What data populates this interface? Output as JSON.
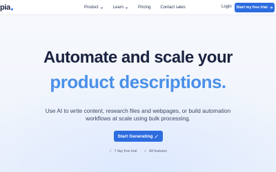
{
  "header": {
    "logo_text": "pia",
    "nav": [
      {
        "label": "Product",
        "has_dropdown": true
      },
      {
        "label": "Learn",
        "has_dropdown": true
      },
      {
        "label": "Pricing",
        "has_dropdown": false
      },
      {
        "label": "Contact sales",
        "has_dropdown": false
      }
    ],
    "login_label": "Login",
    "trial_label": "Start my free trial",
    "trial_icon": "arrow-right-icon"
  },
  "hero": {
    "headline_line1": "Automate and scale your",
    "headline_line2": "product descriptions.",
    "subtext": "Use AI to write content, research files and webpages, or build automation workflows at scale using bulk processing.",
    "cta_label": "Start Generating",
    "cta_icon": "magic-wand-icon",
    "features": [
      "7 day free trial",
      "All features"
    ]
  },
  "colors": {
    "accent": "#2d6cdf",
    "headline_dark": "#1a2340",
    "headline_blue": "#4a90e8"
  }
}
